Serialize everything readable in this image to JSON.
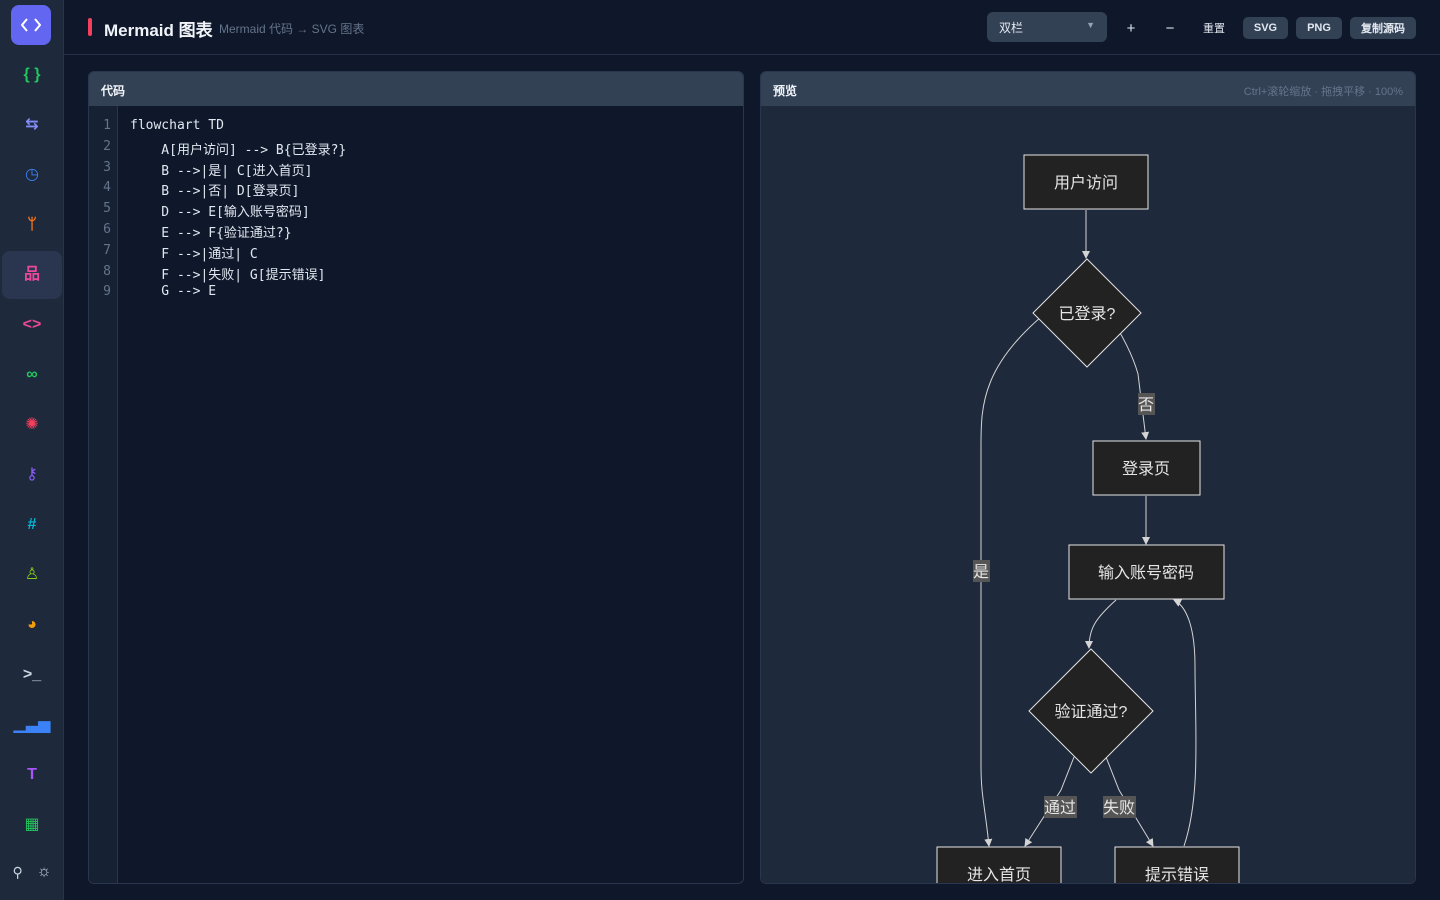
{
  "header": {
    "title": "Mermaid 图表",
    "subtitle": "Mermaid 代码 → SVG 图表",
    "layout_select": "双栏",
    "zoom_in": "+",
    "zoom_out": "−",
    "reset": "重置",
    "export_svg": "SVG",
    "export_png": "PNG",
    "copy_source": "复制源码"
  },
  "sidebar": {
    "items": [
      {
        "icon": "braces-icon",
        "glyph": "{ }",
        "color": "#22c55e"
      },
      {
        "icon": "swap-icon",
        "glyph": "⇆",
        "color": "#818cf8"
      },
      {
        "icon": "clock-icon",
        "glyph": "◷",
        "color": "#3b82f6"
      },
      {
        "icon": "git-branch-icon",
        "glyph": "ᛘ",
        "color": "#f97316"
      },
      {
        "icon": "diagram-icon",
        "glyph": "品",
        "color": "#ec4899",
        "active": true
      },
      {
        "icon": "code-icon",
        "glyph": "<>",
        "color": "#ec4899"
      },
      {
        "icon": "link-icon",
        "glyph": "∞",
        "color": "#22c55e"
      },
      {
        "icon": "sun-icon",
        "glyph": "✺",
        "color": "#f43f5e"
      },
      {
        "icon": "key-icon",
        "glyph": "⚷",
        "color": "#8b5cf6"
      },
      {
        "icon": "hash-icon",
        "glyph": "#",
        "color": "#06b6d4"
      },
      {
        "icon": "antenna-icon",
        "glyph": "♙",
        "color": "#84cc16"
      },
      {
        "icon": "palette-icon",
        "glyph": "◕",
        "color": "#f59e0b"
      },
      {
        "icon": "terminal-icon",
        "glyph": ">_",
        "color": "#cbd5e1"
      },
      {
        "icon": "bar-chart-icon",
        "glyph": "▁▃▅",
        "color": "#3b82f6"
      },
      {
        "icon": "text-icon",
        "glyph": "T",
        "color": "#a855f7"
      },
      {
        "icon": "qr-icon",
        "glyph": "▦",
        "color": "#22c55e"
      }
    ],
    "footer": {
      "pin_glyph": "⚲",
      "theme_glyph": "☼"
    }
  },
  "editor": {
    "label": "代码",
    "lines": [
      "flowchart TD",
      "    A[用户访问] --> B{已登录?}",
      "    B -->|是| C[进入首页]",
      "    B -->|否| D[登录页]",
      "    D --> E[输入账号密码]",
      "    E --> F{验证通过?}",
      "    F -->|通过| C",
      "    F -->|失败| G[提示错误]",
      "    G --> E"
    ]
  },
  "preview": {
    "label": "预览",
    "hint": "Ctrl+滚轮缩放 · 拖拽平移 · 100%",
    "nodes": {
      "a": "用户访问",
      "b": "已登录?",
      "c": "进入首页",
      "d": "登录页",
      "e": "输入账号密码",
      "f": "验证通过?",
      "g": "提示错误"
    },
    "edge_labels": {
      "yes": "是",
      "no": "否",
      "pass": "通过",
      "fail": "失败"
    }
  }
}
